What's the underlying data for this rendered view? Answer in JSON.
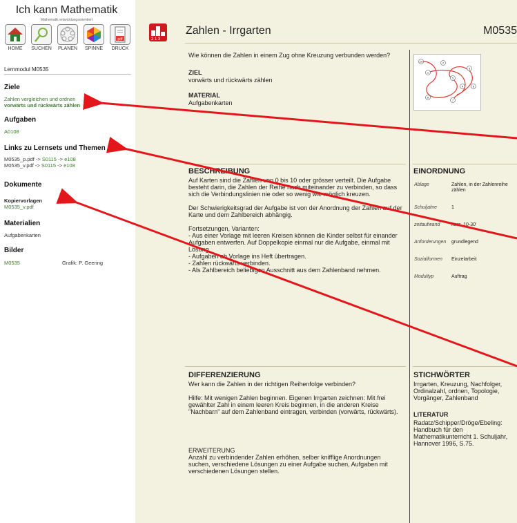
{
  "sidebar": {
    "brand": "Ich kann Mathematik",
    "brand_sub": "Mathematik entwicklungsorientiert",
    "nav": [
      {
        "label": "HOME",
        "icon": "home-icon"
      },
      {
        "label": "SUCHEN",
        "icon": "magnifier-icon"
      },
      {
        "label": "PLANEN",
        "icon": "planner-icon"
      },
      {
        "label": "SPINNE",
        "icon": "spider-icon"
      },
      {
        "label": "DRUCK",
        "icon": "pdf-print-icon"
      }
    ],
    "module": "Lernmodul M0535",
    "ziele": {
      "heading": "Ziele",
      "line1": "Zahlen vergleichen und ordnen",
      "line2": "vorwärts und rückwärts zählen"
    },
    "aufgaben": {
      "heading": "Aufgaben",
      "item": "A0108"
    },
    "links": {
      "heading": "Links zu Lernsets und Themen",
      "rows": [
        {
          "file": "M0535_p.pdf ->",
          "set": "S0115",
          "sep": "->",
          "topic": "e108"
        },
        {
          "file": "M0535_v.pdf ->",
          "set": "S0115",
          "sep": "->",
          "topic": "e108"
        }
      ]
    },
    "dokumente": {
      "heading": "Dokumente",
      "sub": "Kopiervorlagen",
      "file": "M0535_v.pdf"
    },
    "materialien": {
      "heading": "Materialien",
      "item": "Aufgabenkarten"
    },
    "bilder": {
      "heading": "Bilder",
      "item": "M0535",
      "credit": "Grafik: P. Geering"
    }
  },
  "main": {
    "badge": "2 1 3",
    "title": "Zahlen - Irrgarten",
    "code": "M0535",
    "question": "Wie können die Zahlen in einem Zug ohne Kreuzung verbunden werden?",
    "ziel_h": "ZIEL",
    "ziel": "vorwärts und rückwärts zählen",
    "material_h": "MATERIAL",
    "material": "Aufgabenkarten",
    "beschreibung_h": "BESCHREIBUNG",
    "beschreibung": "Auf Karten sind die Zahlen von 0 bis 10 oder grösser verteilt. Die Aufgabe besteht darin, die Zahlen der Reihe nach miteinander zu verbinden, so dass sich die Verbindungslinien nie oder so wenig wie möglich kreuzen.\n\nDer Schwierigkeitsgrad der Aufgabe ist von der Anordnung der Zahlen auf der Karte und dem Zahlbereich abhängig.\n\nFortsetzungen, Varianten:\n- Aus einer Vorlage mit leeren Kreisen können die Kinder selbst für einander\n Aufgaben entwerfen. Auf Doppelkopie einmal nur die Aufgabe, einmal mit Lösung.\n- Aufgaben ab Vorlage ins Heft übertragen.\n- Zahlen rückwärts verbinden.\n- Als Zahlbereich beliebigen Ausschnitt aus dem Zahlenband nehmen.",
    "einordnung_h": "EINORDNUNG",
    "einordnung": [
      {
        "label": "Ablage",
        "value": "Zahlen, in der Zahlenreihe zählen"
      },
      {
        "label": "Schuljahre",
        "value": "1"
      },
      {
        "label": "zeitaufwand",
        "value": "kurz, 10-30'"
      },
      {
        "label": "Anforderungen",
        "value": "grundlegend"
      },
      {
        "label": "Sozialformen",
        "value": "Einzelarbeit"
      },
      {
        "label": "Modultyp",
        "value": "Auftrag"
      }
    ],
    "differenzierung_h": "DIFFERENZIERUNG",
    "differenzierung": "Wer kann die Zahlen in der richtigen Reihenfolge verbinden?\n\nHilfe: Mit wenigen Zahlen beginnen. Eigenen Irrgarten zeichnen: Mit frei gewählter Zahl in einem leeren Kreis beginnen, in die anderen Kreise \"Nachbarn\" auf dem Zahlenband eintragen, verbinden (vorwärts, rückwärts).",
    "erweiterung_h": "ERWEITERUNG",
    "erweiterung": "Anzahl zu verbindender Zahlen erhöhen, selber knifflige Anordnungen suchen, verschiedene Lösungen zu einer Aufgabe suchen, Aufgaben mit verschiedenen Lösungen stellen.",
    "stichwoerter_h": "STICHWÖRTER",
    "stichwoerter": "Irrgarten, Kreuzung, Nachfolger, Ordinalzahl, ordnen, Topologie, Vorgänger, Zahlenband",
    "literatur_h": "LITERATUR",
    "literatur": "Radatz/Schipper/Dröge/Ebeling: Handbuch für den Mathematikunterricht 1. Schuljahr, Hannover 1996, S.75."
  },
  "maze_numbers": [
    "10",
    "2",
    "3",
    "1",
    "5",
    "4",
    "6",
    "8",
    "7"
  ]
}
